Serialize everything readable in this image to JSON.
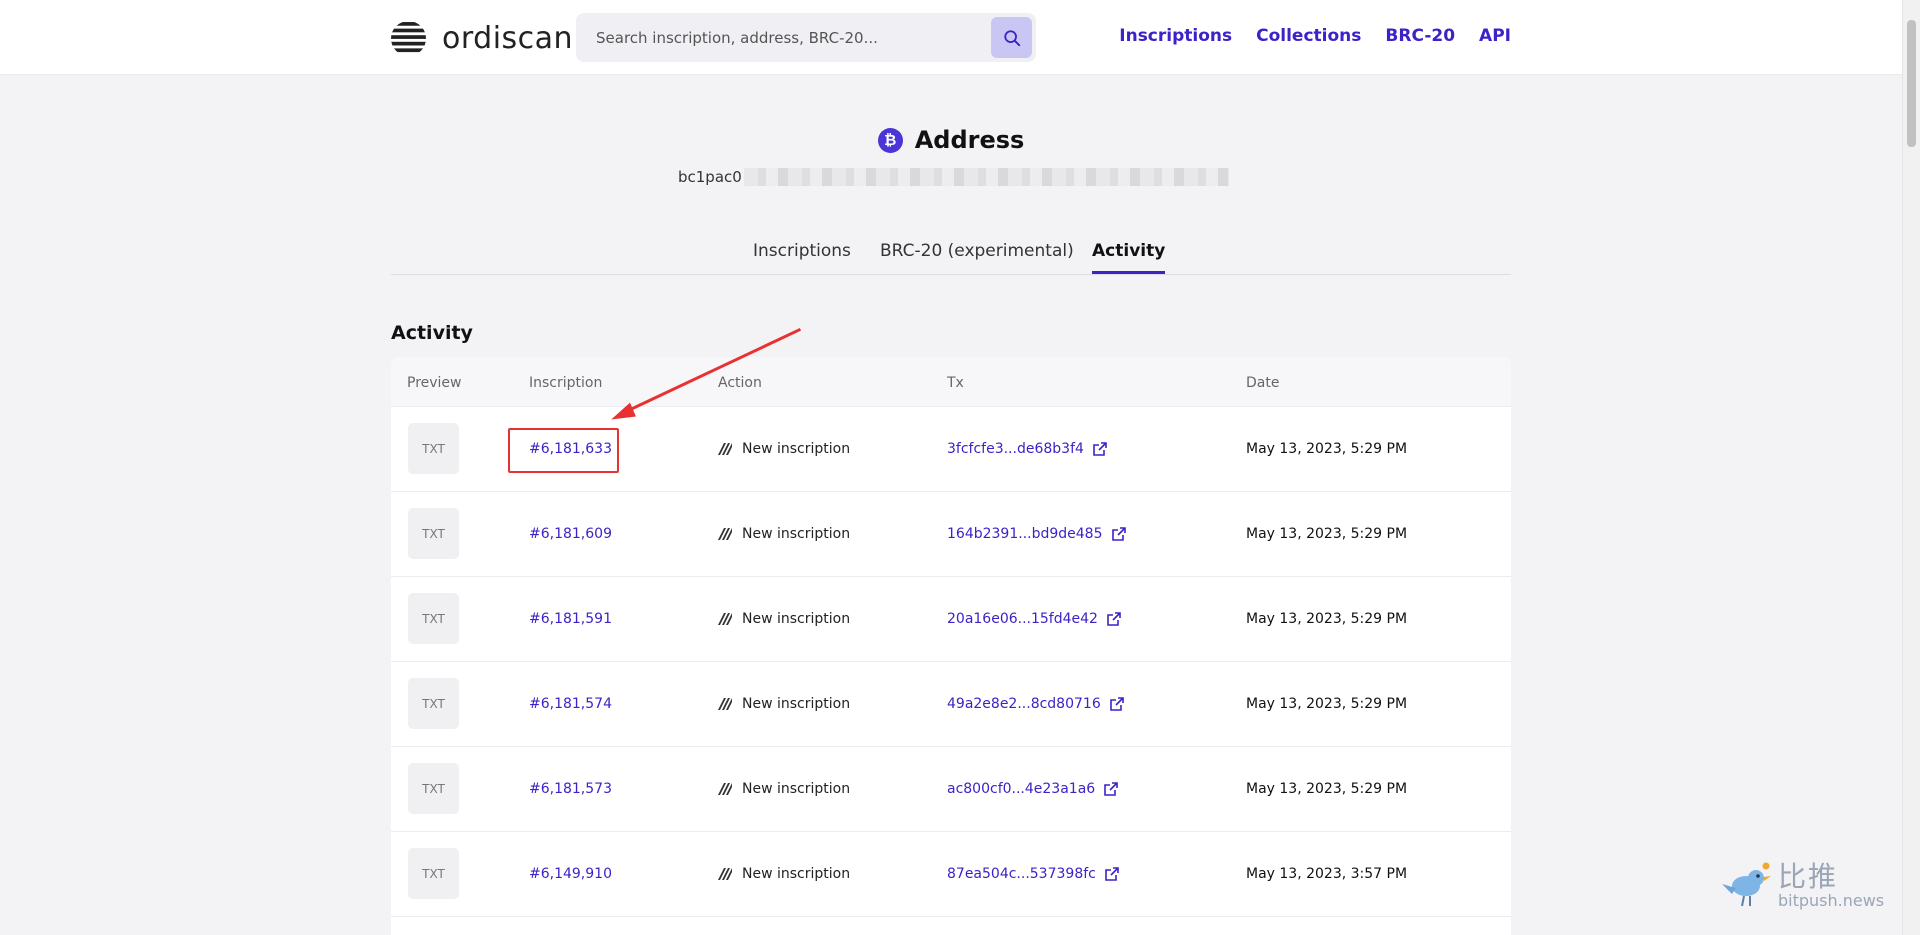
{
  "header": {
    "logo_text": "ordiscan",
    "search_placeholder": "Search inscription, address, BRC-20...",
    "nav": [
      "Inscriptions",
      "Collections",
      "BRC-20",
      "API"
    ]
  },
  "page": {
    "title": "Address",
    "address_prefix": "bc1pac0"
  },
  "tabs": [
    "Inscriptions",
    "BRC-20 (experimental)",
    "Activity"
  ],
  "active_tab": "Activity",
  "section_title": "Activity",
  "table": {
    "headers": [
      "Preview",
      "Inscription",
      "Action",
      "Tx",
      "Date"
    ],
    "rows": [
      {
        "preview": "TXT",
        "inscription": "#6,181,633",
        "action": "New inscription",
        "tx": "3fcfcfe3...de68b3f4",
        "date": "May 13, 2023, 5:29 PM"
      },
      {
        "preview": "TXT",
        "inscription": "#6,181,609",
        "action": "New inscription",
        "tx": "164b2391...bd9de485",
        "date": "May 13, 2023, 5:29 PM"
      },
      {
        "preview": "TXT",
        "inscription": "#6,181,591",
        "action": "New inscription",
        "tx": "20a16e06...15fd4e42",
        "date": "May 13, 2023, 5:29 PM"
      },
      {
        "preview": "TXT",
        "inscription": "#6,181,574",
        "action": "New inscription",
        "tx": "49a2e8e2...8cd80716",
        "date": "May 13, 2023, 5:29 PM"
      },
      {
        "preview": "TXT",
        "inscription": "#6,181,573",
        "action": "New inscription",
        "tx": "ac800cf0...4e23a1a6",
        "date": "May 13, 2023, 5:29 PM"
      },
      {
        "preview": "TXT",
        "inscription": "#6,149,910",
        "action": "New inscription",
        "tx": "87ea504c...537398fc",
        "date": "May 13, 2023, 3:57 PM"
      }
    ]
  },
  "watermark": {
    "cn": "比推",
    "en": "bitpush.news"
  },
  "colors": {
    "accent": "#3c23c7",
    "annotation": "#e83232",
    "background": "#f3f3f6"
  },
  "icons": [
    "logo-icon",
    "search-icon",
    "bitcoin-icon",
    "inscription-action-icon",
    "external-link-icon",
    "bird-icon"
  ]
}
